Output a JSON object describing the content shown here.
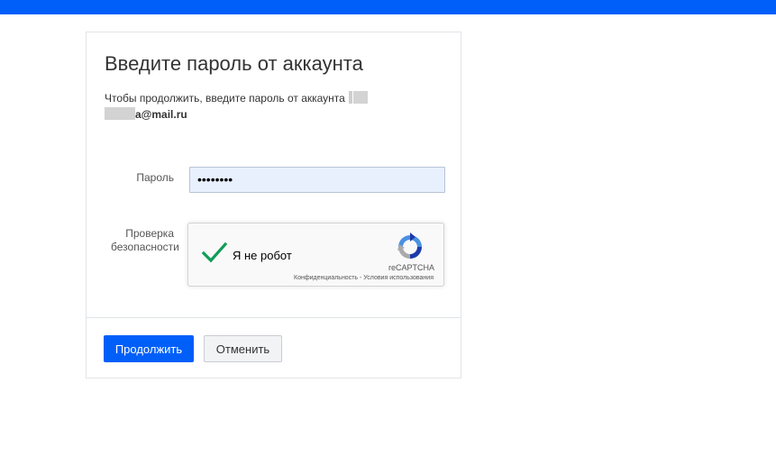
{
  "header": {
    "bar_color": "#005ff9"
  },
  "dialog": {
    "title": "Введите пароль от аккаунта",
    "description": "Чтобы продолжить, введите пароль от аккаунта",
    "account_email_suffix": "a@mail.ru"
  },
  "form": {
    "password_label": "Пароль",
    "password_value": "••••••••",
    "security_label": "Проверка безопасности"
  },
  "captcha": {
    "label": "Я не робот",
    "brand": "reCAPTCHA",
    "privacy_link": "Конфиденциальность",
    "separator": " - ",
    "terms_link": "Условия использования",
    "checked": true
  },
  "actions": {
    "continue_label": "Продолжить",
    "cancel_label": "Отменить",
    "primary_color": "#005ff9"
  }
}
